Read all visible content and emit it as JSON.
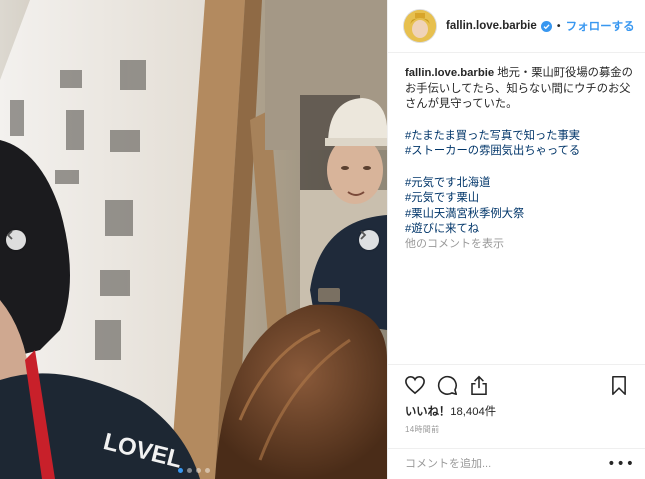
{
  "post": {
    "username": "fallin.love.barbie",
    "follow_label": "フォローする",
    "separator": "•",
    "caption_line1": "地元・栗山町役場の募金のお手伝いしてたら、知らない間にウチのお父さんが見守っていた。",
    "hashtags_group1": [
      "#たまたま買った写真で知った事実",
      "#ストーカーの雰囲気出ちゃってる"
    ],
    "hashtags_group2": [
      "#元気です北海道",
      "#元気です栗山",
      "#栗山天満宮秋季例大祭",
      "#遊びに来てね"
    ],
    "view_more_comments": "他のコメントを表示",
    "likes_label": "いいね！",
    "likes_count": "18,404件",
    "time_ago": "14時間前",
    "comment_placeholder": "コメントを追加...",
    "more_options": "•••"
  },
  "photo": {
    "carousel_dots": 4,
    "active_dot": 1,
    "jacket_text": "LOVEL"
  },
  "icons": {
    "like": "heart-icon",
    "comment": "comment-bubble-icon",
    "share": "share-icon",
    "save": "bookmark-icon",
    "verified": "verified-badge-icon",
    "prev": "chevron-left-icon",
    "next": "chevron-right-icon"
  },
  "colors": {
    "link_blue": "#3897f0",
    "hashtag": "#003569",
    "muted": "#999999",
    "text": "#262626"
  }
}
